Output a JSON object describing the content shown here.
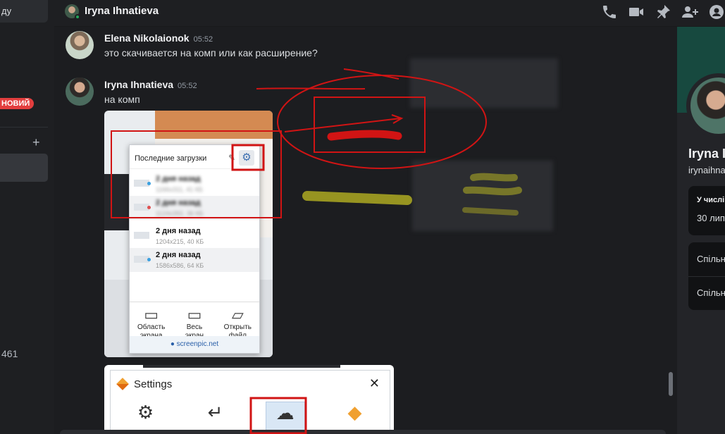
{
  "sidebar": {
    "search_label": "ду",
    "new_badge": "НОВИЙ",
    "add_symbol": "+",
    "counter": "461"
  },
  "header": {
    "title": "Iryna Ihnatieva",
    "icons": [
      "phone-call-icon",
      "video-call-icon",
      "pin-icon",
      "add-friend-icon",
      "user-profile-icon"
    ]
  },
  "messages": [
    {
      "author": "Elena Nikolaionok",
      "time": "05:52",
      "text": "это скачивается на комп или как расширение?"
    },
    {
      "author": "Iryna Ihnatieva",
      "time": "05:52",
      "text": "на комп"
    }
  ],
  "popup": {
    "title": "Последние загрузки",
    "rows": [
      {
        "when": "2 дня назад",
        "meta": "1166x311, 41 КБ"
      },
      {
        "when": "2 дня назад",
        "meta": "1124x392, 36 КБ"
      },
      {
        "when": "2 дня назад",
        "meta": "1204x215, 40 КБ"
      },
      {
        "when": "2 дня назад",
        "meta": "1586x586, 64 КБ"
      }
    ],
    "actions": [
      {
        "line1": "Область",
        "line2": "экрана"
      },
      {
        "line1": "Весь",
        "line2": "экран"
      },
      {
        "line1": "Открыть",
        "line2": "файл"
      }
    ],
    "footer": "screenpic.net"
  },
  "settings_window": {
    "title": "Settings",
    "close": "✕"
  },
  "profile": {
    "name": "Iryna I",
    "username": "irynaihna",
    "member_since_label": "У числі",
    "member_since_value": "30 лип",
    "mutual_1": "Спільн",
    "mutual_2": "Спільн"
  },
  "colors": {
    "background": "#1c1d20",
    "sidebar": "#1e1f22",
    "accent_red": "#d11414",
    "annotation_yellow": "#b7b322",
    "online": "#23a55a",
    "banner": "#17493f"
  }
}
